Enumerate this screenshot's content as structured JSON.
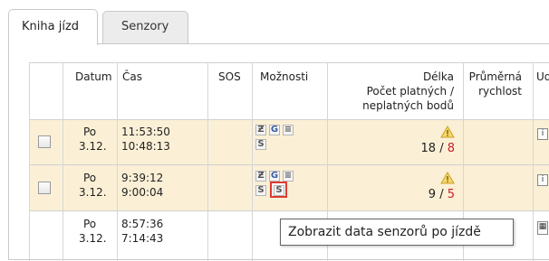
{
  "tabs": [
    {
      "label": "Kniha jízd",
      "active": true
    },
    {
      "label": "Senzory",
      "active": false
    }
  ],
  "table": {
    "headers": {
      "datum": "Datum",
      "cas": "Čas",
      "sos": "SOS",
      "moznosti": "Možnosti",
      "delka_line1": "Délka",
      "delka_line2": "Počet platných /",
      "delka_line3": "neplatných bodů",
      "prumerna_line1": "Průměrná",
      "prumerna_line2": "rychlost",
      "next_col": "Ud"
    },
    "rows": [
      {
        "day": "Po",
        "date": "3.12.",
        "time_start": "11:53:50",
        "time_end": "10:48:13",
        "valid": "18",
        "sep": " / ",
        "invalid": "8",
        "highlight": true
      },
      {
        "day": "Po",
        "date": "3.12.",
        "time_start": "9:39:12",
        "time_end": "9:00:04",
        "valid": "9",
        "sep": " / ",
        "invalid": "5",
        "highlight": true
      },
      {
        "day": "Po",
        "date": "3.12.",
        "time_start": "8:57:36",
        "time_end": "7:14:43",
        "highlight": false
      }
    ]
  },
  "icons": {
    "route_icon": "Ƶ",
    "g_icon": "G",
    "list_icon": "≡",
    "s_icon": "S",
    "sensor_icon": "S"
  },
  "tooltip": {
    "text": "Zobrazit data senzorů po jízdě"
  },
  "colors": {
    "highlight_row": "#fbf0d6",
    "invalid_count": "#c8202a",
    "active_icon_border": "#e03a2f"
  }
}
